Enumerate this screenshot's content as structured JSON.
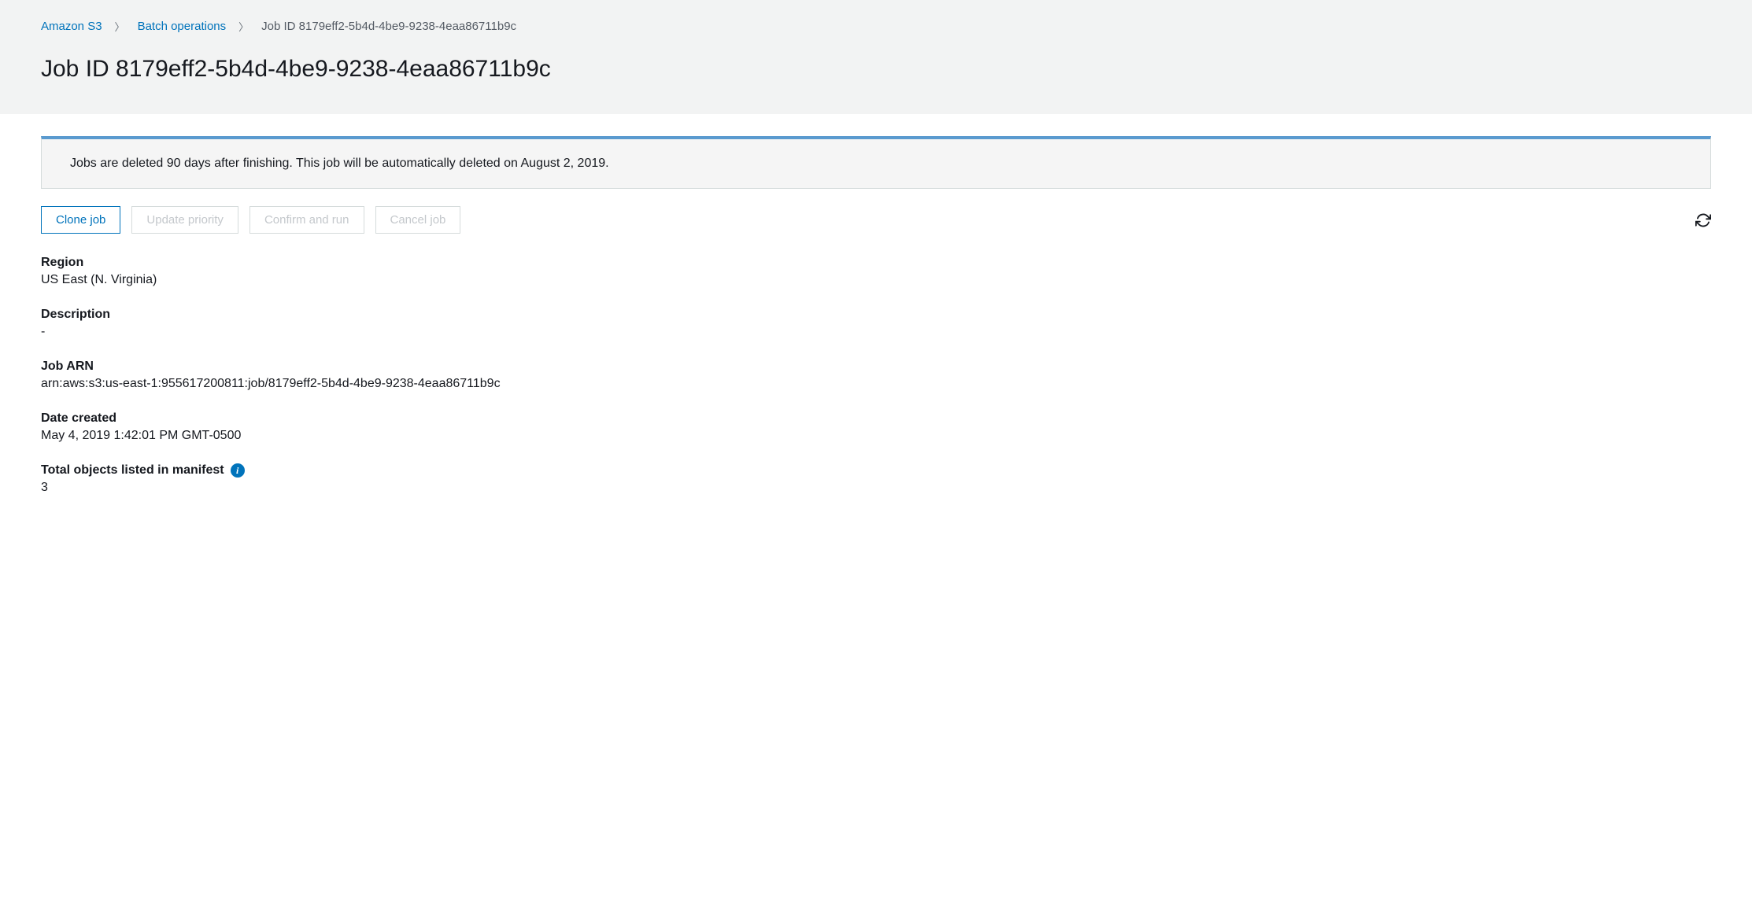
{
  "breadcrumb": {
    "items": [
      {
        "label": "Amazon S3",
        "link": true
      },
      {
        "label": "Batch operations",
        "link": true
      },
      {
        "label": "Job ID 8179eff2-5b4d-4be9-9238-4eaa86711b9c",
        "link": false
      }
    ]
  },
  "page_title": "Job ID 8179eff2-5b4d-4be9-9238-4eaa86711b9c",
  "banner": {
    "message": "Jobs are deleted 90 days after finishing. This job will be automatically deleted on August 2, 2019."
  },
  "actions": {
    "clone": "Clone job",
    "update_priority": "Update priority",
    "confirm_run": "Confirm and run",
    "cancel": "Cancel job"
  },
  "details": {
    "region": {
      "label": "Region",
      "value": "US East (N. Virginia)"
    },
    "description": {
      "label": "Description",
      "value": "-"
    },
    "job_arn": {
      "label": "Job ARN",
      "value": "arn:aws:s3:us-east-1:955617200811:job/8179eff2-5b4d-4be9-9238-4eaa86711b9c"
    },
    "date_created": {
      "label": "Date created",
      "value": "May 4, 2019 1:42:01 PM GMT-0500"
    },
    "total_objects": {
      "label": "Total objects listed in manifest",
      "value": "3"
    }
  }
}
